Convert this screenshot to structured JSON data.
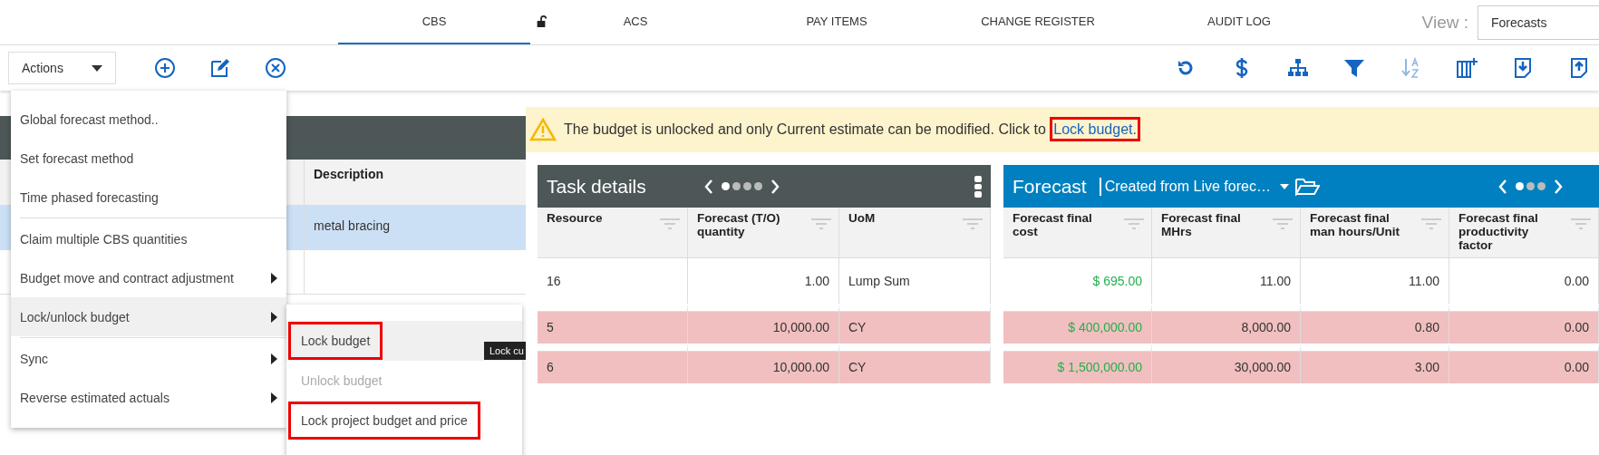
{
  "nav": {
    "tabs": [
      {
        "label": "CBS",
        "selected": true
      },
      {
        "label": "ACS",
        "selected": false
      },
      {
        "label": "PAY ITEMS",
        "selected": false
      },
      {
        "label": "CHANGE REGISTER",
        "selected": false
      },
      {
        "label": "AUDIT LOG",
        "selected": false
      }
    ],
    "view_label": "View :",
    "view_value": "Forecasts"
  },
  "toolbar": {
    "actions_label": "Actions"
  },
  "background_grid": {
    "column": "Description",
    "rows": [
      {
        "description": "metal bracing",
        "selected": true
      }
    ]
  },
  "banner": {
    "text": "The budget is unlocked and only Current estimate can be modified. Click to ",
    "link": {
      "label": "Lock budget.",
      "annotated": true
    }
  },
  "actions_menu": {
    "items": [
      {
        "kind": "item",
        "label": "Global forecast method..",
        "submenu": false,
        "selected": false
      },
      {
        "kind": "item",
        "label": "Set forecast method",
        "submenu": false,
        "selected": false
      },
      {
        "kind": "item",
        "label": "Time phased forecasting",
        "submenu": false,
        "selected": false
      },
      {
        "kind": "divider"
      },
      {
        "kind": "item",
        "label": "Claim multiple CBS quantities",
        "submenu": false,
        "selected": false
      },
      {
        "kind": "item",
        "label": "Budget move and contract adjustment",
        "submenu": true,
        "selected": false
      },
      {
        "kind": "item",
        "label": "Lock/unlock budget",
        "submenu": true,
        "selected": true
      },
      {
        "kind": "divider"
      },
      {
        "kind": "item",
        "label": "Sync",
        "submenu": true,
        "selected": false
      },
      {
        "kind": "item",
        "label": "Reverse estimated actuals",
        "submenu": true,
        "selected": false
      }
    ]
  },
  "submenu": {
    "items": [
      {
        "label": "Lock budget",
        "selected": true,
        "disabled": false,
        "annotated": true
      },
      {
        "label": "Unlock budget",
        "selected": false,
        "disabled": true,
        "annotated": false
      },
      {
        "label": "Lock project budget and price",
        "selected": false,
        "disabled": false,
        "annotated": true
      }
    ]
  },
  "tooltip": "Lock cu",
  "task_panel": {
    "title": "Task details",
    "pager": [
      {
        "selected": true
      },
      {
        "selected": false
      },
      {
        "selected": false
      },
      {
        "selected": false
      }
    ],
    "columns": [
      {
        "label": "Resource",
        "kind": "text"
      },
      {
        "label": "Forecast (T/O) quantity",
        "kind": "number"
      },
      {
        "label": "UoM",
        "kind": "text"
      }
    ],
    "rows": [
      {
        "cells": [
          "16",
          "1.00",
          "Lump Sum"
        ],
        "flagged": false
      },
      {
        "cells": [
          "5",
          "10,000.00",
          "CY"
        ],
        "flagged": true
      },
      {
        "cells": [
          "6",
          "10,000.00",
          "CY"
        ],
        "flagged": true
      }
    ]
  },
  "forecast_panel": {
    "title": "Forecast",
    "source": "Created from Live forec…",
    "pager": [
      {
        "selected": true
      },
      {
        "selected": false
      },
      {
        "selected": false
      }
    ],
    "columns": [
      {
        "label": "Forecast final cost",
        "kind": "currency"
      },
      {
        "label": "Forecast final MHrs",
        "kind": "number"
      },
      {
        "label": "Forecast final man hours/Unit",
        "kind": "number"
      },
      {
        "label": "Forecast final productivity factor",
        "kind": "number"
      }
    ],
    "rows": [
      {
        "cells": [
          "$ 695.00",
          "11.00",
          "11.00",
          "0.00"
        ],
        "flagged": false
      },
      {
        "cells": [
          "$ 400,000.00",
          "8,000.00",
          "0.80",
          "0.00"
        ],
        "flagged": true
      },
      {
        "cells": [
          "$ 1,500,000.00",
          "30,000.00",
          "3.00",
          "0.00"
        ],
        "flagged": true
      }
    ]
  }
}
